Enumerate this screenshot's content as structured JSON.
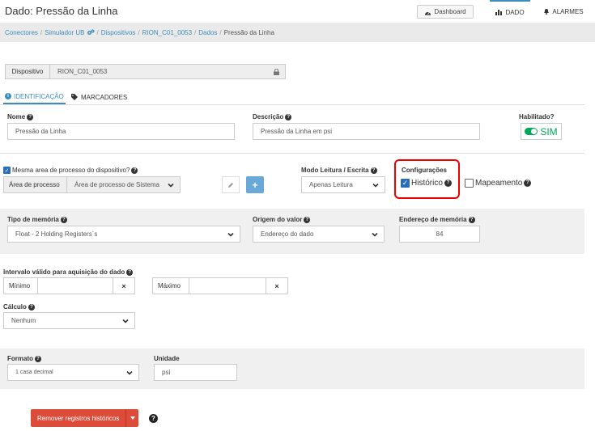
{
  "header": {
    "title": "Dado: Pressão da Linha",
    "dashboard_label": "Dashboard",
    "tab_dado": "DADO",
    "tab_alarmes": "ALARMES"
  },
  "breadcrumb": {
    "items": [
      "Conectores",
      "Simulador UB",
      "Dispositivos",
      "RION_C01_0053",
      "Dados"
    ],
    "current": "Pressão da Linha"
  },
  "device": {
    "label": "Dispositivo",
    "value": "RION_C01_0053"
  },
  "tabs": {
    "identificacao": "IDENTIFICAÇÃO",
    "marcadores": "MARCADORES"
  },
  "identification": {
    "nome_label": "Nome",
    "nome_value": "Pressão da Linha",
    "descricao_label": "Descrição",
    "descricao_value": "Pressão da Linha em psi",
    "habilitado_label": "Habilitado?",
    "habilitado_value": "SIM"
  },
  "process": {
    "same_area_label": "Mesma area de processo do dispositivo?",
    "area_addon": "Área de processo",
    "area_value": "Área de processo de Sistema",
    "modo_label": "Modo Leitura / Escrita",
    "modo_value": "Apenas Leitura",
    "config_label": "Configurações",
    "historico_label": "Histórico",
    "mapeamento_label": "Mapeamento"
  },
  "memory": {
    "tipo_label": "Tipo de memória",
    "tipo_value": "Float - 2 Holding Registers´s",
    "origem_label": "Origem do valor",
    "origem_value": "Endereço do dado",
    "endereco_label": "Endereço de memória",
    "endereco_value": "84"
  },
  "interval": {
    "label": "Intervalo válido para aquisição do dado",
    "min_addon": "Mínimo",
    "max_addon": "Máximo",
    "clear": "×"
  },
  "calc": {
    "label": "Cálculo",
    "value": "Nenhum"
  },
  "format": {
    "formato_label": "Formato",
    "formato_value": "1 casa decimal",
    "unidade_label": "Unidade",
    "unidade_value": "psi"
  },
  "actions": {
    "remove_label": "Remover registros históricos"
  },
  "colors": {
    "accent": "#3c8dbc",
    "danger": "#dd4b39",
    "success": "#00a65a",
    "highlight": "#e00000"
  }
}
